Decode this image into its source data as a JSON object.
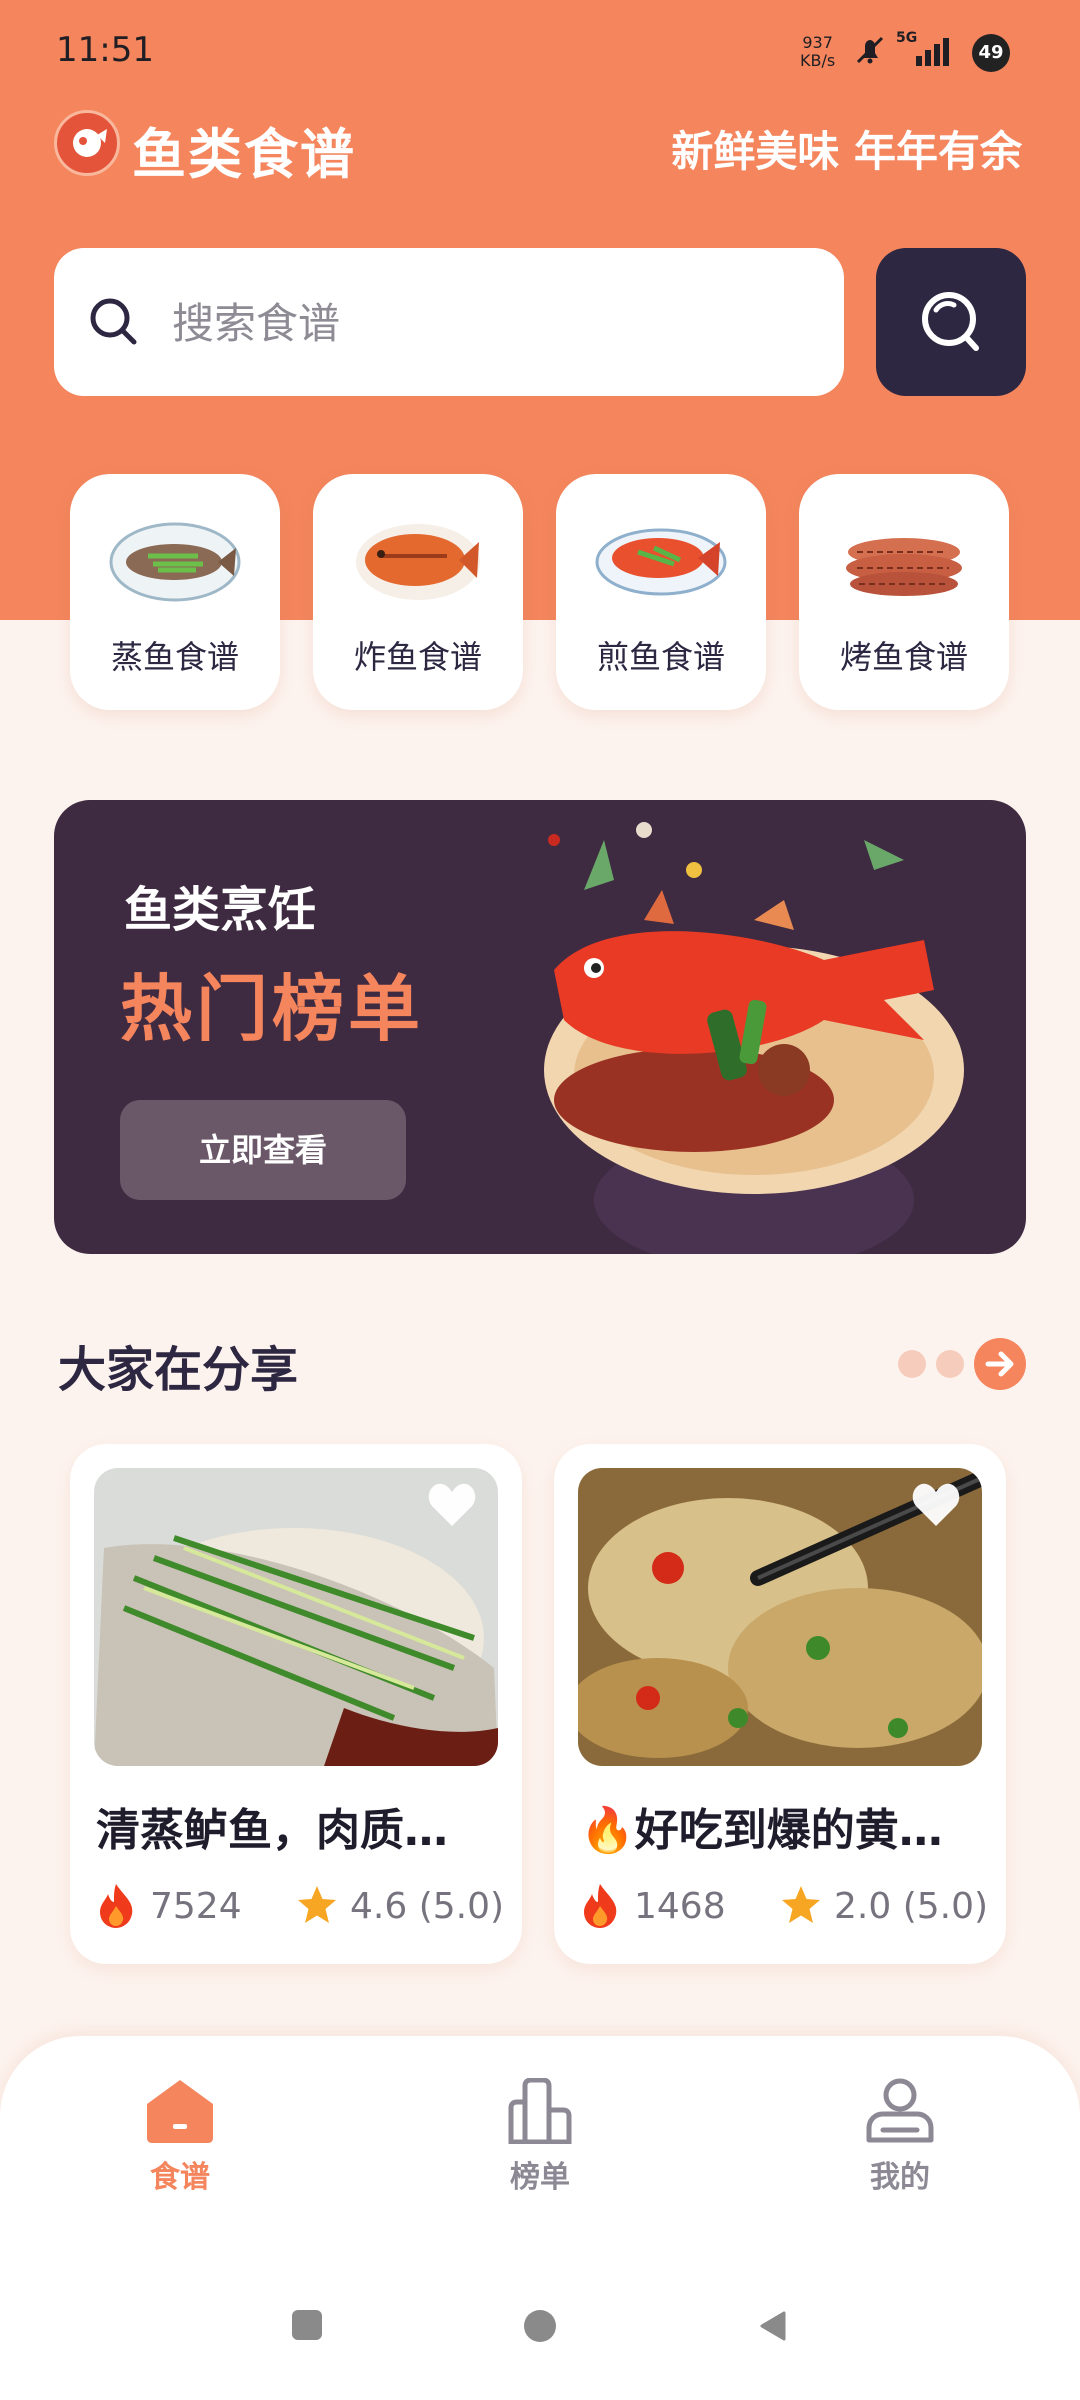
{
  "status_bar": {
    "time": "11:51",
    "net_speed_value": "937",
    "net_speed_unit": "KB/s",
    "network": "5G",
    "battery": "49"
  },
  "header": {
    "app_title": "鱼类食谱",
    "slogan": "新鲜美味 年年有余"
  },
  "search": {
    "placeholder": "搜索食谱"
  },
  "categories": [
    {
      "label": "蒸鱼食谱",
      "icon": "steamed-fish-icon"
    },
    {
      "label": "炸鱼食谱",
      "icon": "fried-fish-icon"
    },
    {
      "label": "煎鱼食谱",
      "icon": "pan-fried-fish-icon"
    },
    {
      "label": "烤鱼食谱",
      "icon": "grilled-fish-icon"
    }
  ],
  "banner": {
    "subtitle": "鱼类烹饪",
    "title": "热门榜单",
    "button_label": "立即查看"
  },
  "share_section": {
    "title": "大家在分享",
    "posts": [
      {
        "title": "清蒸鲈鱼，肉质…",
        "views": "7524",
        "rating": "4.6 (5.0)"
      },
      {
        "title": "🔥好吃到爆的黄…",
        "views": "1468",
        "rating": "2.0 (5.0)"
      }
    ]
  },
  "bottom_nav": {
    "items": [
      {
        "label": "食谱",
        "icon": "home-icon",
        "active": true
      },
      {
        "label": "榜单",
        "icon": "ranking-icon",
        "active": false
      },
      {
        "label": "我的",
        "icon": "profile-icon",
        "active": false
      }
    ]
  },
  "colors": {
    "accent": "#f4855d",
    "dark": "#2d2742",
    "background": "#fdf3ee",
    "banner": "#3e2a41"
  }
}
